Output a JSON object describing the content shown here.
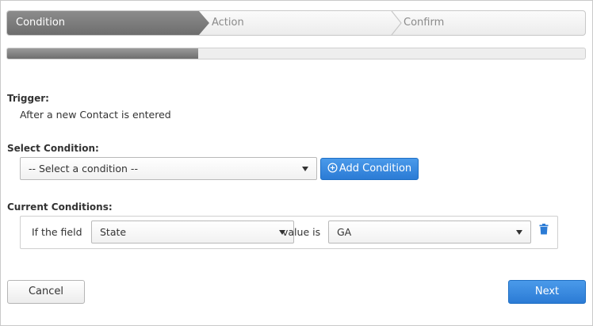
{
  "wizard": {
    "steps": [
      {
        "label": "Condition",
        "state": "active"
      },
      {
        "label": "Action",
        "state": "inactive"
      },
      {
        "label": "Confirm",
        "state": "inactive"
      }
    ],
    "progress_fraction": 0.33
  },
  "trigger": {
    "heading": "Trigger:",
    "text": "After a new Contact is entered"
  },
  "select_condition": {
    "heading": "Select Condition:",
    "selected": "-- Select a condition --",
    "add_button_label": "Add Condition",
    "add_icon": "plus-circle-icon"
  },
  "current_conditions": {
    "heading": "Current Conditions:",
    "rows": [
      {
        "prefix": "If the field",
        "field": "State",
        "operator": "value is",
        "value": "GA",
        "delete_icon": "trash-icon"
      }
    ]
  },
  "footer": {
    "cancel_label": "Cancel",
    "next_label": "Next"
  },
  "colors": {
    "accent": "#2b7bd5",
    "delete_icon": "#2b7bd5",
    "active_step": "#7a7a7a"
  }
}
